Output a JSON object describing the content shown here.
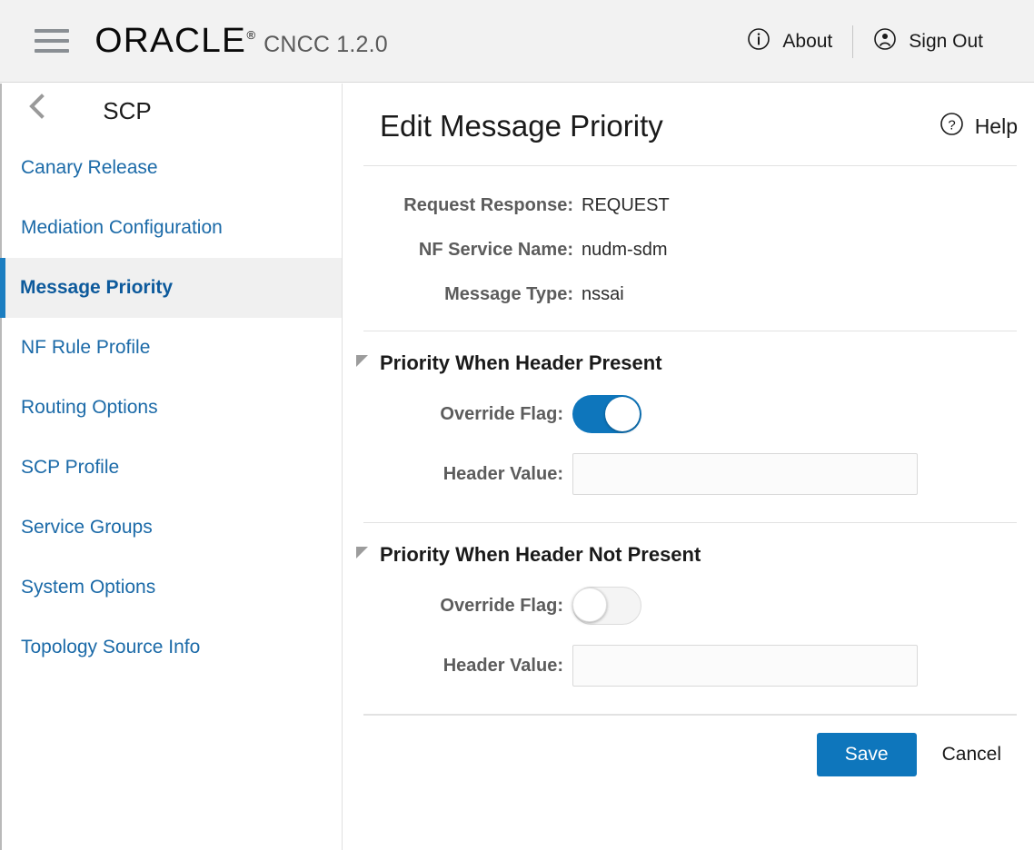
{
  "topbar": {
    "menu_icon": "hamburger-icon",
    "brand": "ORACLE",
    "registered_mark": "®",
    "product": "CNCC 1.2.0",
    "about_label": "About",
    "about_icon": "info-circle-icon",
    "signout_label": "Sign Out",
    "signout_icon": "user-circle-icon"
  },
  "sidebar": {
    "back_icon": "chevron-left-icon",
    "title": "SCP",
    "items": [
      {
        "label": "Canary Release",
        "active": false
      },
      {
        "label": "Mediation Configuration",
        "active": false
      },
      {
        "label": "Message Priority",
        "active": true
      },
      {
        "label": "NF Rule Profile",
        "active": false
      },
      {
        "label": "Routing Options",
        "active": false
      },
      {
        "label": "SCP Profile",
        "active": false
      },
      {
        "label": "Service Groups",
        "active": false
      },
      {
        "label": "System Options",
        "active": false
      },
      {
        "label": "Topology Source Info",
        "active": false
      }
    ]
  },
  "main": {
    "title": "Edit Message Priority",
    "help_label": "Help",
    "help_icon": "question-circle-icon",
    "readonly_fields": [
      {
        "label": "Request Response:",
        "value": "REQUEST"
      },
      {
        "label": "NF Service Name:",
        "value": "nudm-sdm"
      },
      {
        "label": "Message Type:",
        "value": "nssai"
      }
    ],
    "sections": [
      {
        "title": "Priority When Header Present",
        "collapse_icon": "triangle-expanded-icon",
        "override_label": "Override Flag:",
        "override_on": true,
        "header_value_label": "Header Value:",
        "header_value": "",
        "header_value_placeholder": ""
      },
      {
        "title": "Priority When Header Not Present",
        "collapse_icon": "triangle-expanded-icon",
        "override_label": "Override Flag:",
        "override_on": false,
        "header_value_label": "Header Value:",
        "header_value": "",
        "header_value_placeholder": ""
      }
    ],
    "save_label": "Save",
    "cancel_label": "Cancel"
  },
  "colors": {
    "accent_blue": "#0e76bc",
    "link_blue": "#1b6aa8",
    "active_bg": "#f0f0f0",
    "topbar_bg": "#f2f2f2",
    "label_gray": "#5c5c5c"
  }
}
